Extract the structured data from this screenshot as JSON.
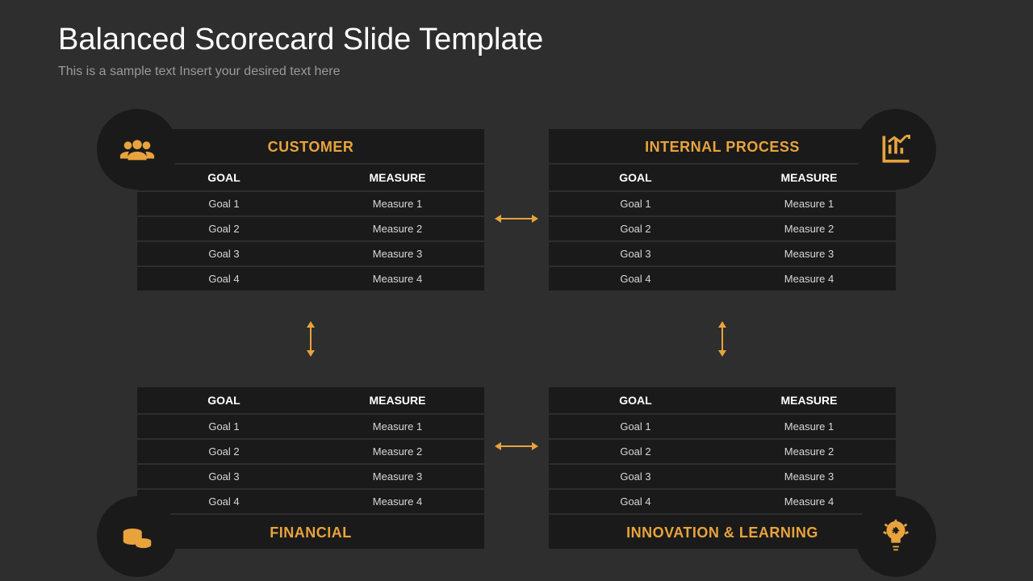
{
  "title": "Balanced Scorecard Slide Template",
  "subtitle": "This is a sample text Insert your desired text here",
  "th_goal": "GOAL",
  "th_measure": "MEASURE",
  "quads": {
    "tl": {
      "title": "CUSTOMER",
      "rows": [
        [
          "Goal 1",
          "Measure 1"
        ],
        [
          "Goal 2",
          "Measure 2"
        ],
        [
          "Goal 3",
          "Measure 3"
        ],
        [
          "Goal 4",
          "Measure 4"
        ]
      ]
    },
    "tr": {
      "title": "INTERNAL PROCESS",
      "rows": [
        [
          "Goal 1",
          "Measure 1"
        ],
        [
          "Goal 2",
          "Measure 2"
        ],
        [
          "Goal 3",
          "Measure 3"
        ],
        [
          "Goal 4",
          "Measure 4"
        ]
      ]
    },
    "bl": {
      "title": "FINANCIAL",
      "rows": [
        [
          "Goal 1",
          "Measure 1"
        ],
        [
          "Goal 2",
          "Measure 2"
        ],
        [
          "Goal 3",
          "Measure 3"
        ],
        [
          "Goal 4",
          "Measure 4"
        ]
      ]
    },
    "br": {
      "title": "INNOVATION & LEARNING",
      "rows": [
        [
          "Goal 1",
          "Measure 1"
        ],
        [
          "Goal 2",
          "Measure 2"
        ],
        [
          "Goal 3",
          "Measure 3"
        ],
        [
          "Goal 4",
          "Measure 4"
        ]
      ]
    }
  }
}
